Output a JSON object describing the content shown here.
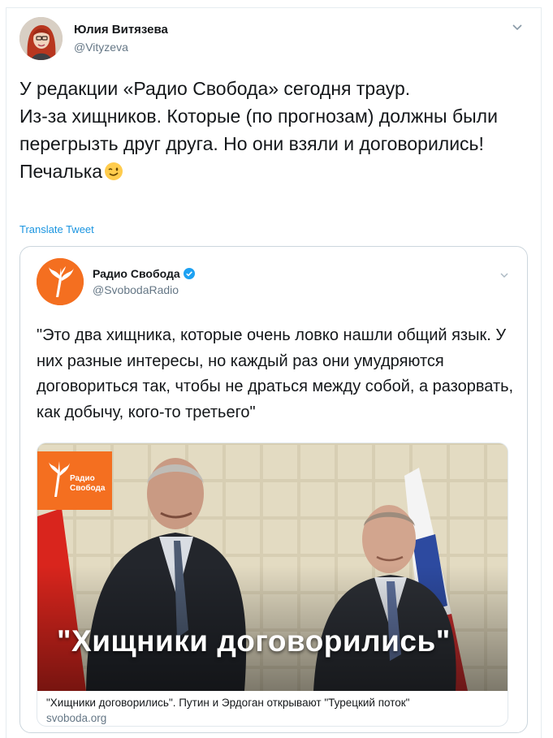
{
  "tweet": {
    "author_name": "Юлия Витязева",
    "author_handle": "@Vityzeva",
    "text": "У редакции «Радио Свобода» сегодня траур.\nИз-за хищников. Которые (по прогнозам) должны были перегрызть друг друга. Но они взяли и договорились!\nПечалька",
    "emoji": "winking-face",
    "translate_label": "Translate Tweet"
  },
  "quoted": {
    "author_name": "Радио Свобода",
    "author_handle": "@SvobodaRadio",
    "verified": true,
    "text": "\"Это два хищника, которые очень ловко нашли общий язык. У них разные интересы, но каждый раз они умудряются договориться так, чтобы не драться между собой, а разорвать, как добычу, кого-то третьего\"",
    "card": {
      "image_logo_text_1": "Радио",
      "image_logo_text_2": "Свобода",
      "image_overlay_title": "\"Хищники договорились\"",
      "title": "\"Хищники договорились\". Путин и Эрдоган открывают \"Турецкий поток\"",
      "domain": "svoboda.org"
    }
  },
  "colors": {
    "link": "#1b95e0",
    "secondary_text": "#657786",
    "brand_orange": "#f46f20",
    "verified": "#1da1f2",
    "border": "#ccd6dd"
  }
}
